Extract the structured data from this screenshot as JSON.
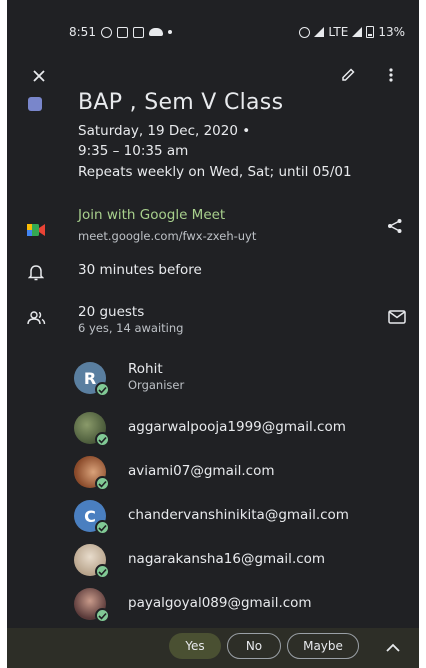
{
  "status_bar": {
    "time": "8:51",
    "network": "LTE",
    "battery": "13%"
  },
  "event": {
    "title": "BAP , Sem V Class",
    "date": "Saturday, 19 Dec, 2020 •",
    "time": "9:35 – 10:35 am",
    "recurrence": "Repeats weekly on Wed, Sat; until 05/01",
    "color": "#7986cb"
  },
  "meet": {
    "label": "Join with Google Meet",
    "url": "meet.google.com/fwx-zxeh-uyt"
  },
  "notification": "30 minutes before",
  "guests": {
    "count_label": "20 guests",
    "summary": "6 yes, 14 awaiting",
    "list": [
      {
        "name": "Rohit",
        "role": "Organiser",
        "initial": "R",
        "avatar_color": "#5a7fa0",
        "avatar_icon": "initial-avatar"
      },
      {
        "name": "aggarwalpooja1999@gmail.com",
        "avatar_icon": "photo-avatar"
      },
      {
        "name": "aviami07@gmail.com",
        "avatar_icon": "photo-avatar"
      },
      {
        "name": "chandervanshinikita@gmail.com",
        "initial": "C",
        "avatar_color": "#4a7fc0",
        "avatar_icon": "initial-avatar"
      },
      {
        "name": "nagarakansha16@gmail.com",
        "avatar_icon": "photo-avatar"
      },
      {
        "name": "payalgoyal089@gmail.com",
        "avatar_icon": "photo-avatar"
      }
    ]
  },
  "rsvp": {
    "yes": "Yes",
    "no": "No",
    "maybe": "Maybe"
  },
  "icons": [
    "close-icon",
    "edit-icon",
    "more-icon",
    "google-meet-icon",
    "share-icon",
    "bell-icon",
    "people-icon",
    "email-icon",
    "chevron-up-icon"
  ]
}
